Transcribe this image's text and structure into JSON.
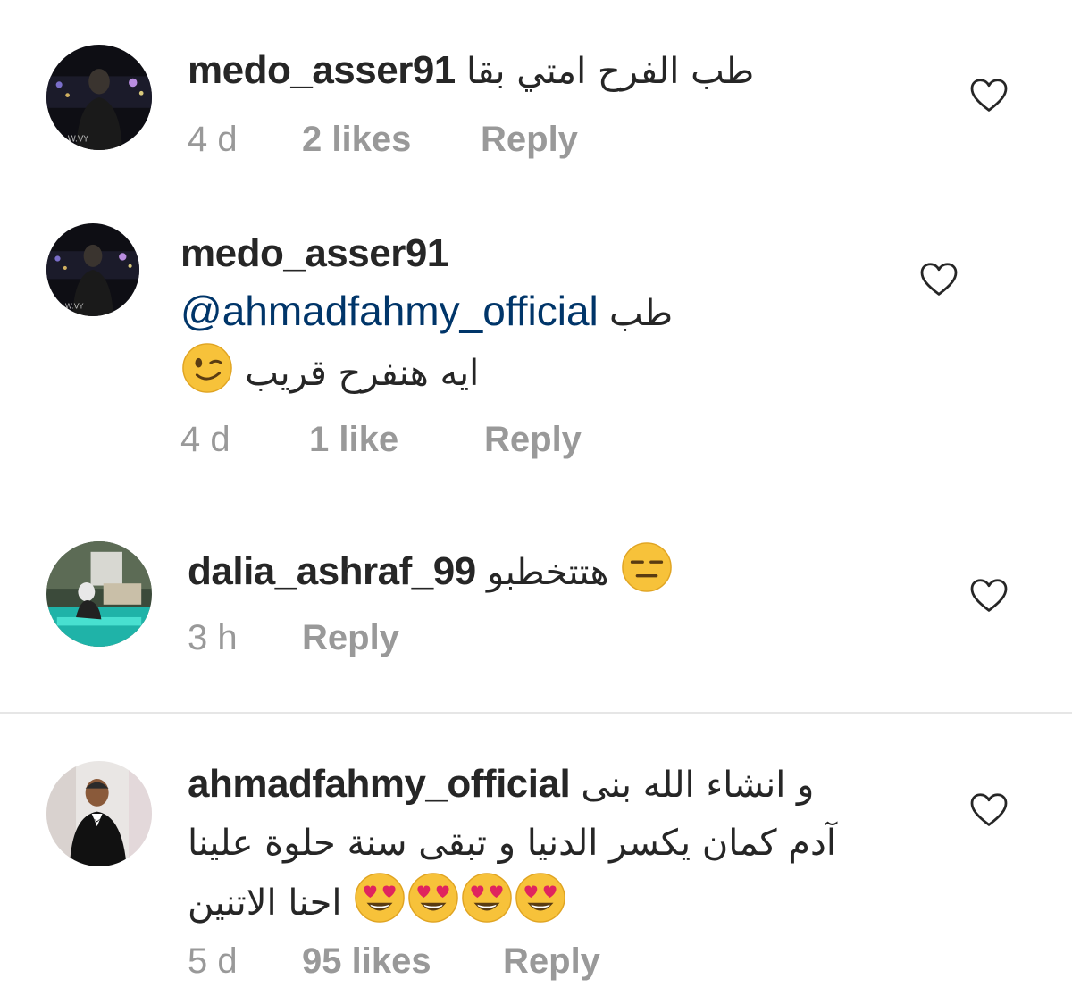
{
  "comments": [
    {
      "username": "medo_asser91",
      "text_ar": "طب الفرح امتي بقا",
      "time": "4 d",
      "likes": "2 likes",
      "reply": "Reply"
    },
    {
      "username": "medo_asser91",
      "mention": "@ahmadfahmy_official",
      "text_ar_prefix": "طب",
      "text_ar_line2": "ايه هنفرح قريب",
      "emoji": "winking-face",
      "time": "4 d",
      "likes": "1 like",
      "reply": "Reply"
    },
    {
      "username": "dalia_ashraf_99",
      "text_ar": "هتتخطبو",
      "emoji": "expressionless-face",
      "time": "3 h",
      "reply": "Reply"
    },
    {
      "username": "ahmadfahmy_official",
      "text_ar_line1": "و انشاء الله بنى",
      "text_ar_line2": "آدم كمان يكسر الدنيا و تبقى سنة حلوة علينا",
      "text_ar_line3": "احنا الاتنين",
      "emoji": "heart-eyes-face",
      "time": "5 d",
      "likes": "95 likes",
      "reply": "Reply"
    }
  ],
  "colors": {
    "text": "#262626",
    "meta": "#999999",
    "mention": "#003569",
    "divider": "#e6e6e6",
    "emoji_yellow": "#f7c23a"
  },
  "icons": {
    "like": "heart-outline-icon"
  }
}
